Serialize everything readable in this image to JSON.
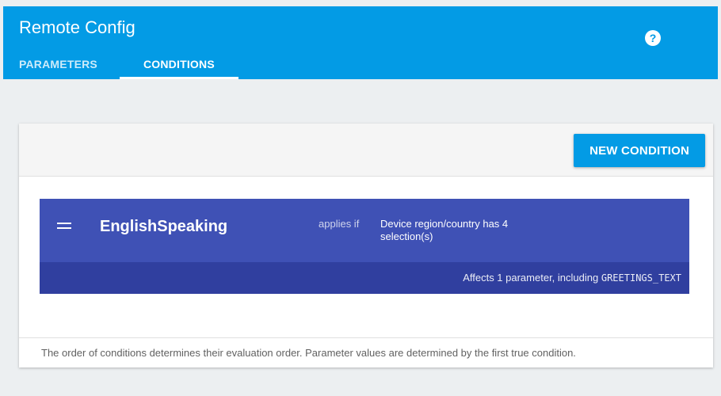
{
  "app": {
    "title": "Remote Config"
  },
  "header": {
    "help_glyph": "?",
    "tabs": [
      {
        "label": "PARAMETERS",
        "active": false
      },
      {
        "label": "CONDITIONS",
        "active": true
      }
    ]
  },
  "toolbar": {
    "new_condition_label": "NEW CONDITION"
  },
  "condition": {
    "name": "EnglishSpeaking",
    "applies_if_label": "applies if",
    "rule": "Device region/country has 4 selection(s)",
    "affects_prefix": "Affects 1 parameter, including",
    "affects_param": "GREETINGS_TEXT"
  },
  "footer": {
    "note": "The order of conditions determines their evaluation order. Parameter values are determined by the first true condition."
  },
  "colors": {
    "header_bg": "#039be5",
    "condition_bg": "#3f51b5",
    "condition_footer_bg": "#303f9f",
    "page_bg": "#eceff1"
  },
  "icons": {
    "help": "help-circle-icon",
    "drag": "drag-handle-icon"
  }
}
